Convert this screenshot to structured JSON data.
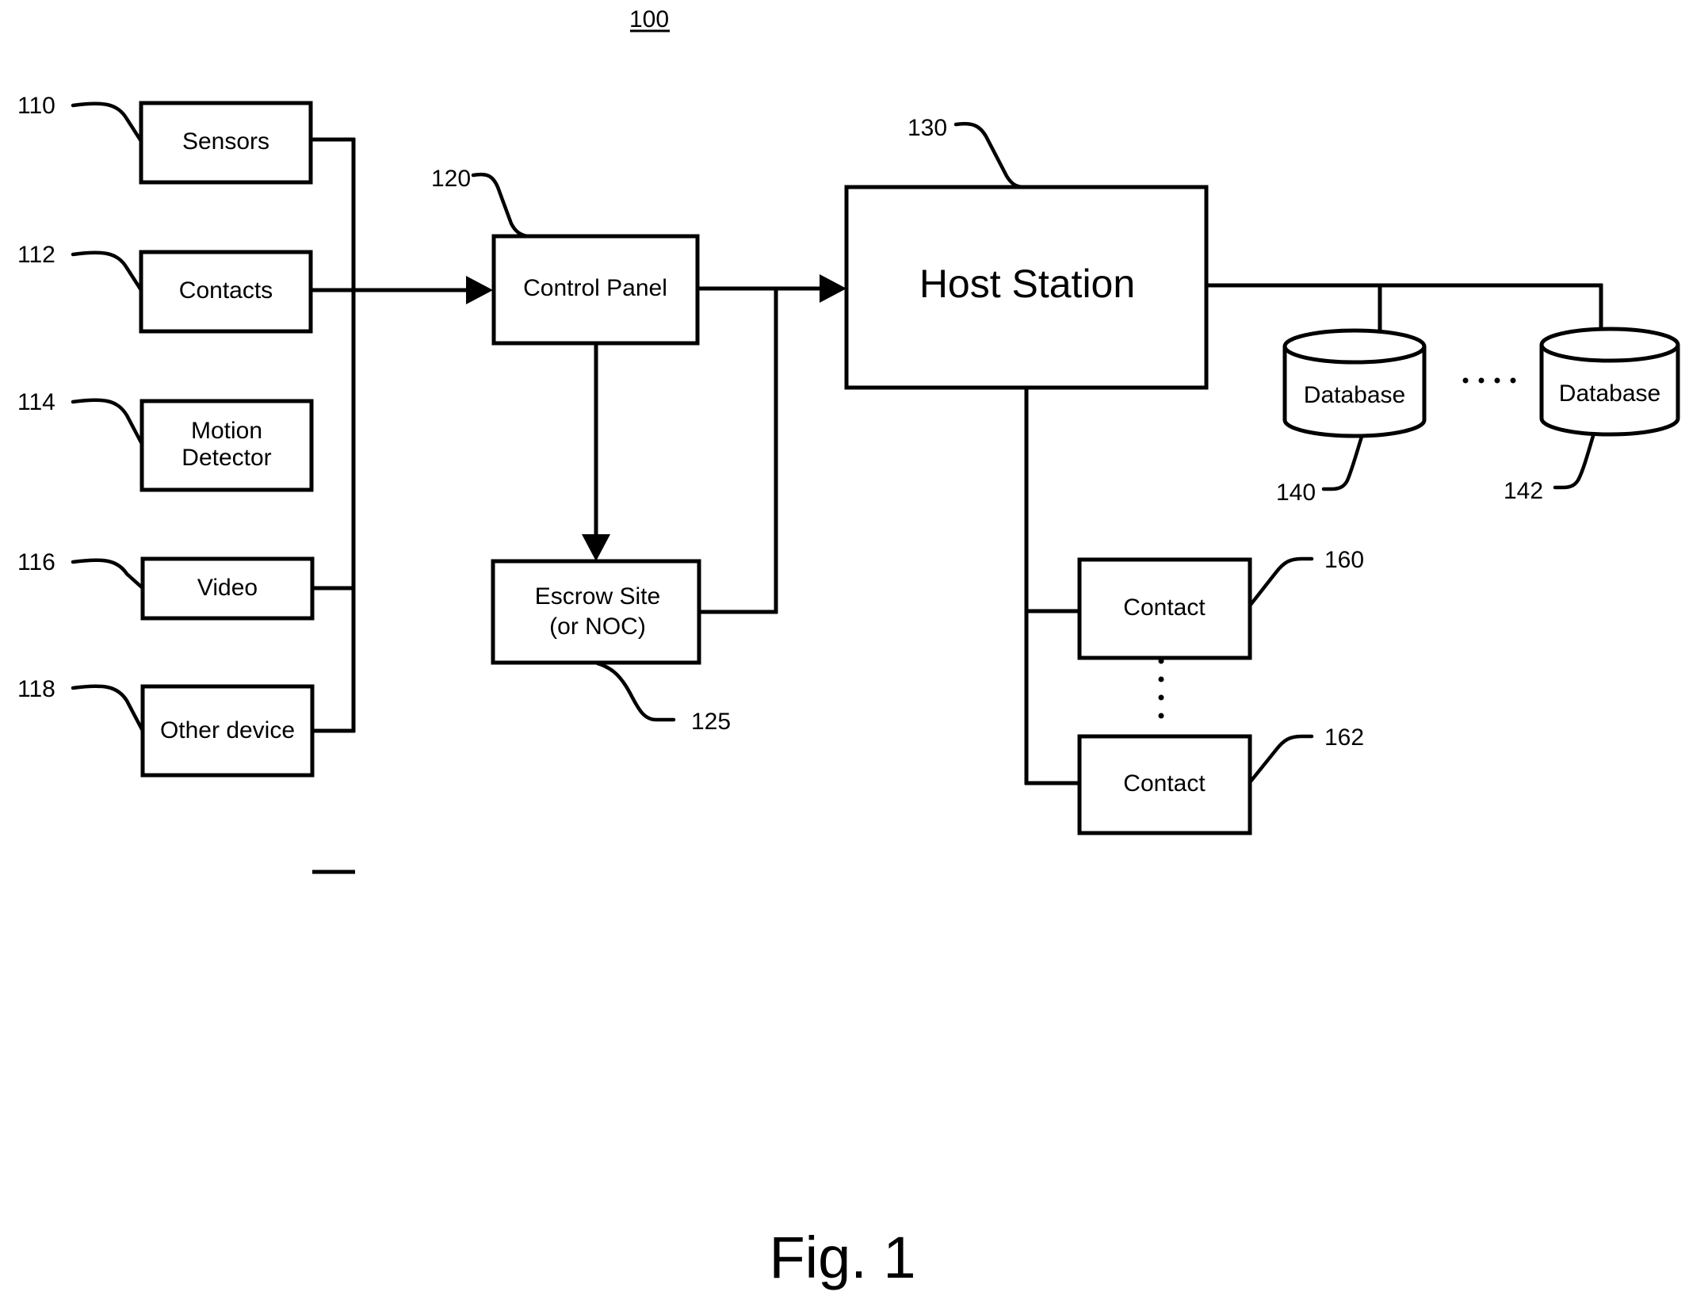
{
  "figure": {
    "number_label": "100",
    "caption": "Fig. 1"
  },
  "nodes": {
    "sensors": {
      "label": "Sensors",
      "ref": "110"
    },
    "contacts_in": {
      "label": "Contacts",
      "ref": "112"
    },
    "motion": {
      "label_line1": "Motion",
      "label_line2": "Detector",
      "ref": "114"
    },
    "video": {
      "label": "Video",
      "ref": "116"
    },
    "other": {
      "label": "Other device",
      "ref": "118"
    },
    "control_panel": {
      "label": "Control Panel",
      "ref": "120"
    },
    "escrow": {
      "label_line1": "Escrow Site",
      "label_line2": "(or NOC)",
      "ref": "125"
    },
    "host": {
      "label": "Host Station",
      "ref": "130"
    },
    "database_1": {
      "label": "Database",
      "ref": "140"
    },
    "database_2": {
      "label": "Database",
      "ref": "142"
    },
    "contact_1": {
      "label": "Contact",
      "ref": "160"
    },
    "contact_2": {
      "label": "Contact",
      "ref": "162"
    }
  },
  "edges": [
    {
      "from": "sensors",
      "to": "control_panel",
      "arrow": true
    },
    {
      "from": "contacts_in",
      "to": "control_panel",
      "arrow": true
    },
    {
      "from": "motion",
      "to": "control_panel",
      "arrow": true
    },
    {
      "from": "video",
      "to": "control_panel",
      "arrow": true
    },
    {
      "from": "other",
      "to": "control_panel",
      "arrow": true
    },
    {
      "from": "control_panel",
      "to": "escrow",
      "arrow": true
    },
    {
      "from": "control_panel",
      "to": "host",
      "arrow": true
    },
    {
      "from": "escrow",
      "to": "host",
      "arrow": true
    },
    {
      "from": "host",
      "to": "database_1",
      "arrow": false
    },
    {
      "from": "host",
      "to": "database_2",
      "arrow": false
    },
    {
      "from": "host",
      "to": "contact_1",
      "arrow": false
    },
    {
      "from": "host",
      "to": "contact_2",
      "arrow": false
    }
  ]
}
